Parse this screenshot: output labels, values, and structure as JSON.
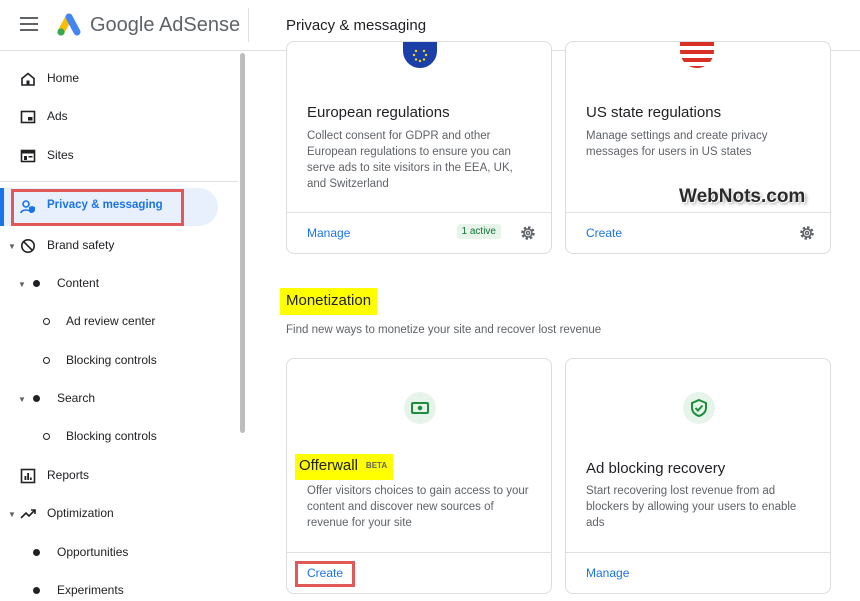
{
  "header": {
    "brand": "Google AdSense",
    "title": "Privacy & messaging"
  },
  "sidebar": {
    "items": [
      {
        "label": "Home",
        "icon": "home-icon"
      },
      {
        "label": "Ads",
        "icon": "ads-icon"
      },
      {
        "label": "Sites",
        "icon": "sites-icon"
      },
      {
        "label": "Privacy & messaging",
        "icon": "privacy-icon",
        "active": true
      },
      {
        "label": "Brand safety",
        "icon": "block-icon"
      },
      {
        "label": "Content"
      },
      {
        "label": "Ad review center"
      },
      {
        "label": "Blocking controls"
      },
      {
        "label": "Search"
      },
      {
        "label": "Blocking controls"
      },
      {
        "label": "Reports",
        "icon": "reports-icon"
      },
      {
        "label": "Optimization",
        "icon": "trending-icon"
      },
      {
        "label": "Opportunities"
      },
      {
        "label": "Experiments"
      }
    ]
  },
  "regulations": {
    "eu": {
      "title": "European regulations",
      "description": "Collect consent for GDPR and other European regulations to ensure you can serve ads to site visitors in the EEA, UK, and Switzerland",
      "action": "Manage",
      "badge": "1 active"
    },
    "us": {
      "title": "US state regulations",
      "description": "Manage settings and create privacy messages for users in US states",
      "action": "Create"
    }
  },
  "watermark": "WebNots.com",
  "monetization": {
    "title": "Monetization",
    "description": "Find new ways to monetize your site and recover lost revenue",
    "offerwall": {
      "title": "Offerwall",
      "badge": "BETA",
      "description": "Offer visitors choices to gain access to your content and discover new sources of revenue for your site",
      "action": "Create"
    },
    "adblock": {
      "title": "Ad blocking recovery",
      "description": "Start recovering lost revenue from ad blockers by allowing your users to enable ads",
      "action": "Manage"
    }
  },
  "colors": {
    "accent": "#1a73e8",
    "highlight": "#ffff00",
    "annotation_border": "#e05858"
  }
}
